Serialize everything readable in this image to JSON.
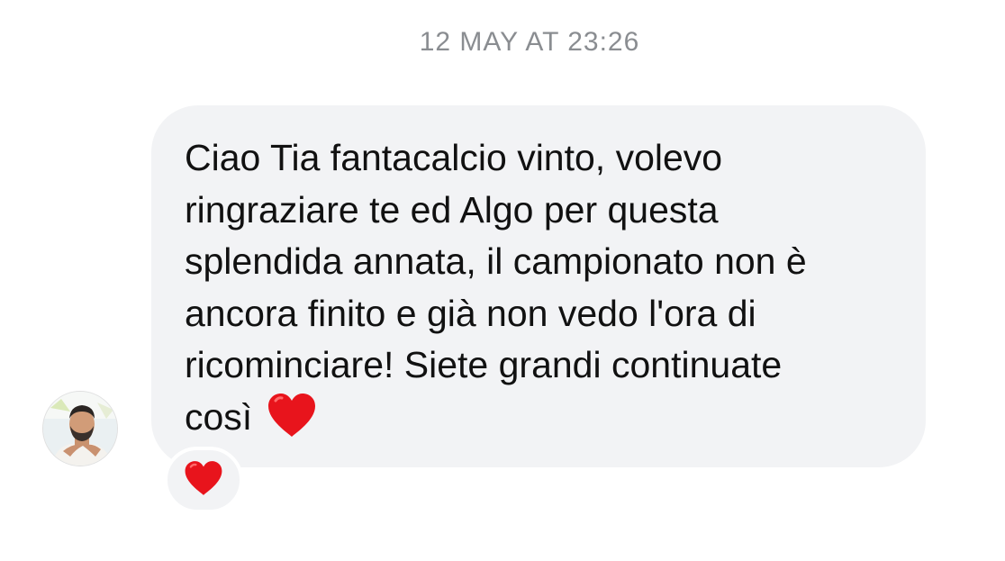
{
  "conversation": {
    "timestamp": "12 MAY AT 23:26"
  },
  "message": {
    "text": "Ciao Tia fantacalcio vinto, volevo\nringraziare te ed Algo per questa\nsplendida annata, il campionato non è\nancora finito e già non vedo l'ora di\nricominciare! Siete grandi continuate\ncosì",
    "emoji": "red-heart-icon",
    "reaction": "red-heart-icon",
    "sender_avatar": "avatar-photo"
  },
  "colors": {
    "bubble": "#f2f3f5",
    "timestamp": "#8a8d91",
    "text": "#111111",
    "heart": "#e8141c"
  }
}
